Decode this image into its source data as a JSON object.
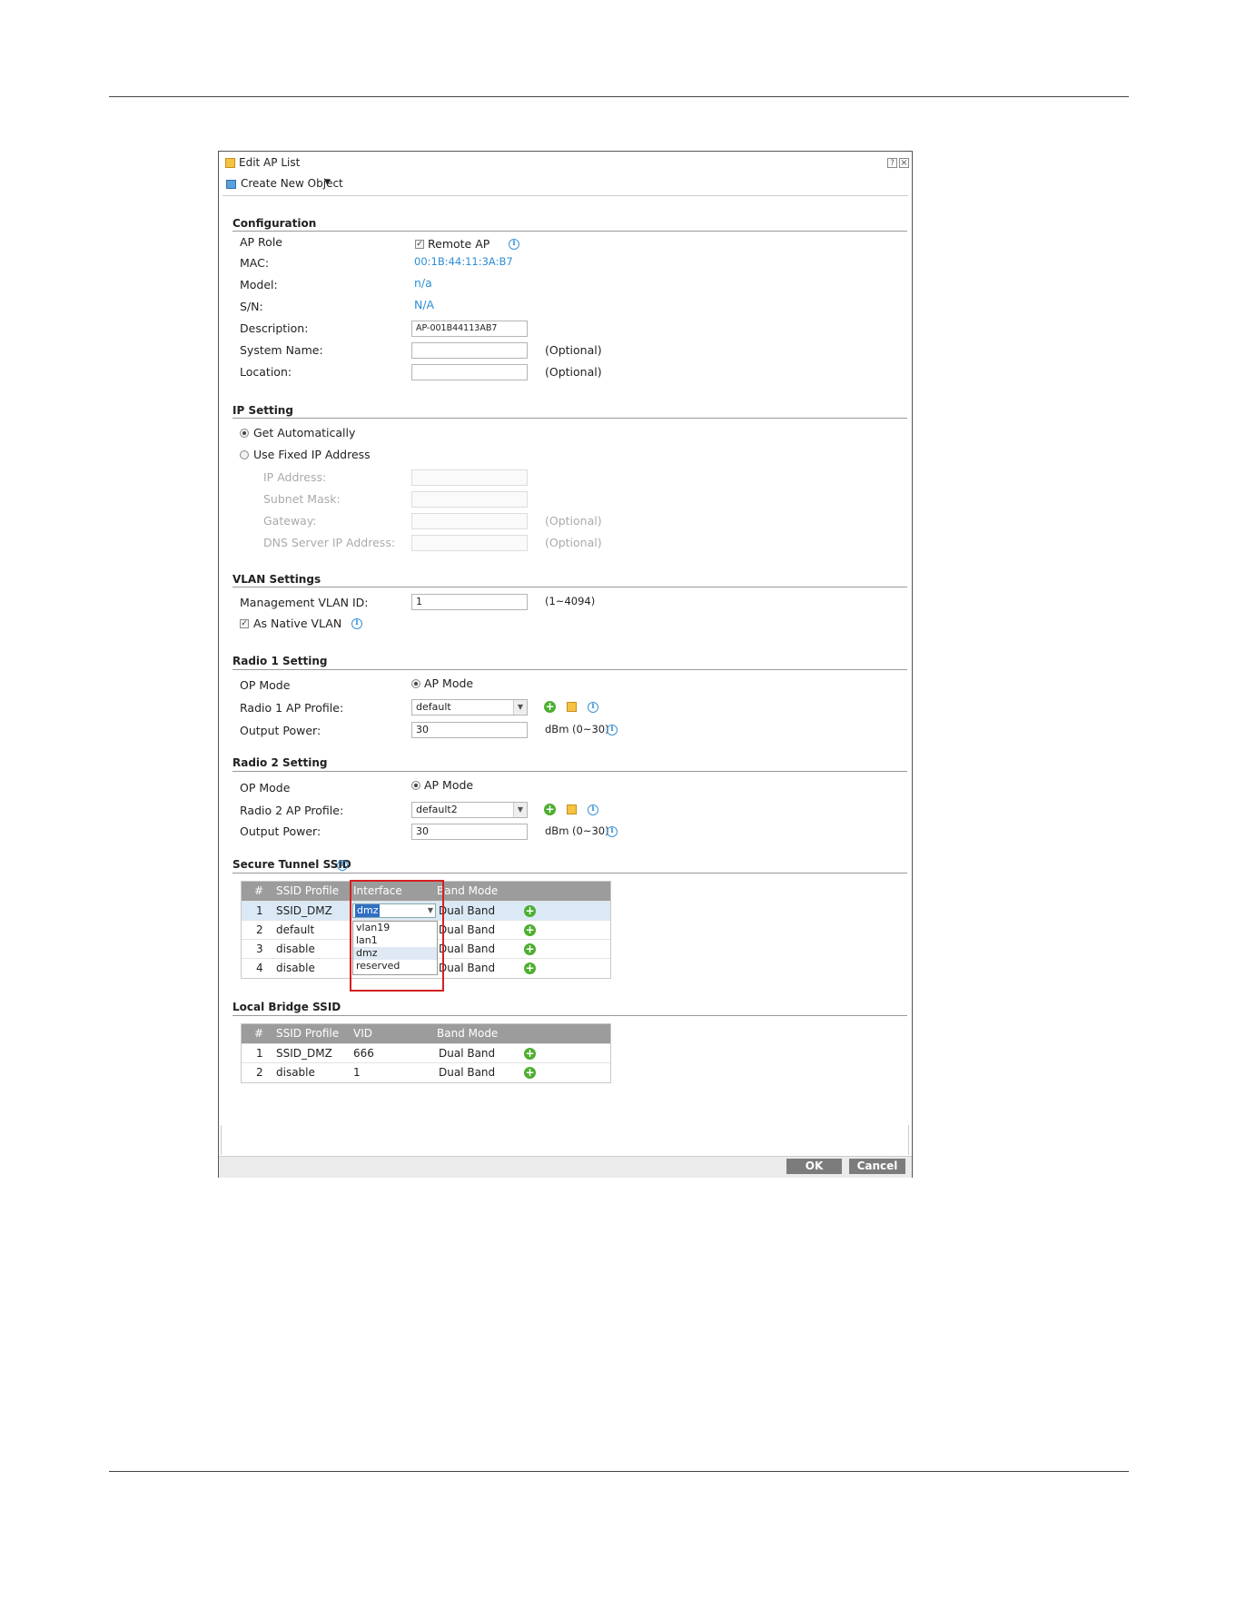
{
  "dialog": {
    "title": "Edit AP List",
    "help_glyph": "?",
    "close_glyph": "×",
    "toolbar": {
      "create_label": "Create New Object",
      "caret": "▼"
    }
  },
  "configuration": {
    "title": "Configuration",
    "ap_role_label": "AP Role",
    "remote_ap_label": "Remote AP",
    "remote_ap_checked": true,
    "mac_label": "MAC:",
    "mac_value": "00:1B:44:11:3A:B7",
    "model_label": "Model:",
    "model_value": "n/a",
    "sn_label": "S/N:",
    "sn_value": "N/A",
    "description_label": "Description:",
    "description_value": "AP-001B44113AB7",
    "system_name_label": "System Name:",
    "system_name_value": "",
    "location_label": "Location:",
    "location_value": "",
    "optional": "(Optional)"
  },
  "ip_setting": {
    "title": "IP Setting",
    "get_auto_label": "Get Automatically",
    "fixed_ip_label": "Use Fixed IP Address",
    "selected": "Get Automatically",
    "ip_address_label": "IP Address:",
    "subnet_mask_label": "Subnet Mask:",
    "gateway_label": "Gateway:",
    "dns_label": "DNS Server IP Address:",
    "optional": "(Optional)"
  },
  "vlan": {
    "title": "VLAN Settings",
    "mgmt_label": "Management VLAN ID:",
    "mgmt_value": "1",
    "range": "(1~4094)",
    "native_label": "As Native VLAN",
    "native_checked": true
  },
  "radio1": {
    "title": "Radio 1 Setting",
    "op_mode_label": "OP Mode",
    "op_mode_value": "AP Mode",
    "profile_label": "Radio 1 AP Profile:",
    "profile_value": "default",
    "output_label": "Output Power:",
    "output_value": "30",
    "output_unit": "dBm (0~30)"
  },
  "radio2": {
    "title": "Radio 2 Setting",
    "op_mode_label": "OP Mode",
    "op_mode_value": "AP Mode",
    "profile_label": "Radio 2 AP Profile:",
    "profile_value": "default2",
    "output_label": "Output Power:",
    "output_value": "30",
    "output_unit": "dBm (0~30)"
  },
  "secure_tunnel": {
    "title": "Secure Tunnel SSID",
    "columns": [
      "#",
      "SSID Profile",
      "Interface",
      "Band Mode"
    ],
    "rows": [
      {
        "num": "1",
        "profile": "SSID_DMZ",
        "interface": "dmz",
        "band": "Dual Band"
      },
      {
        "num": "2",
        "profile": "default",
        "interface": "",
        "band": "Dual Band"
      },
      {
        "num": "3",
        "profile": "disable",
        "interface": "",
        "band": "Dual Band"
      },
      {
        "num": "4",
        "profile": "disable",
        "interface": "",
        "band": "Dual Band"
      }
    ],
    "dropdown_options": [
      "vlan19",
      "lan1",
      "dmz",
      "reserved"
    ],
    "dropdown_highlight": "dmz"
  },
  "local_bridge": {
    "title": "Local Bridge SSID",
    "columns": [
      "#",
      "SSID Profile",
      "VID",
      "Band Mode"
    ],
    "rows": [
      {
        "num": "1",
        "profile": "SSID_DMZ",
        "vid": "666",
        "band": "Dual Band"
      },
      {
        "num": "2",
        "profile": "disable",
        "vid": "1",
        "band": "Dual Band"
      }
    ]
  },
  "buttons": {
    "ok": "OK",
    "cancel": "Cancel"
  },
  "colors": {
    "accent_blue": "#2d8fd5",
    "grid_header": "#9c9c9c",
    "callout_red": "#d42020",
    "add_green": "#4cae2e"
  }
}
